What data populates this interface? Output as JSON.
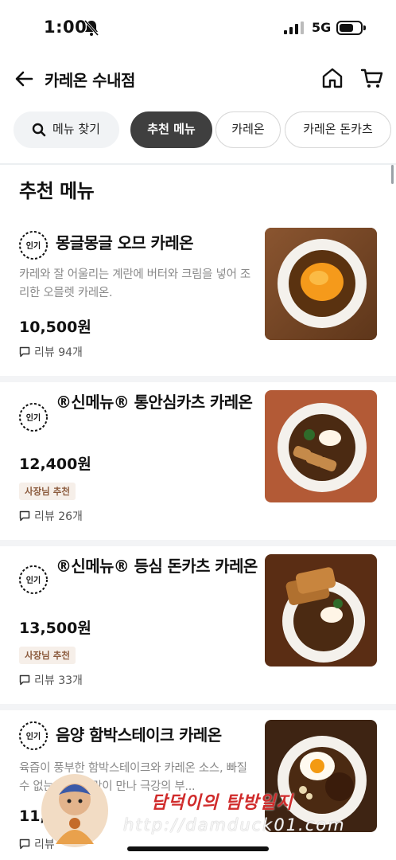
{
  "status_bar": {
    "time": "1:00",
    "network": "5G"
  },
  "header": {
    "title": "카레온 수내점"
  },
  "tabs": [
    {
      "label": "메뉴 찾기"
    },
    {
      "label": "추천 메뉴"
    },
    {
      "label": "카레온"
    },
    {
      "label": "카레온 돈카츠"
    }
  ],
  "section": {
    "title": "추천 메뉴"
  },
  "badge_label": "인기",
  "items": [
    {
      "name": "몽글몽글 오므 카레온",
      "description": "카레와 잘 어울리는 계란에 버터와 크림을 넣어 조리한 오믈렛 카레온.",
      "price": "10,500원",
      "tag": "",
      "reviews": "리뷰 94개"
    },
    {
      "name": "®신메뉴® 통안심카츠 카레온",
      "description": "",
      "price": "12,400원",
      "tag": "사장님 추천",
      "reviews": "리뷰 26개"
    },
    {
      "name": "®신메뉴® 등심 돈카츠 카레온",
      "description": "",
      "price": "13,500원",
      "tag": "사장님 추천",
      "reviews": "리뷰 33개"
    },
    {
      "name": "음양 함박스테이크 카레온",
      "description": "육즙이 풍부한 함박스테이크와 카레온 소스, 빠질 수 없는 반숙 계란이 만나 극강의 부...",
      "price": "11,",
      "tag": "",
      "reviews": "리뷰"
    }
  ],
  "watermark": {
    "title": "담덕이의 탐방일지",
    "url": "http://damduck01.com"
  },
  "colors": {
    "active_tab": "#3f3f3f",
    "tag_bg": "#f6efe9",
    "tag_text": "#8b5a3c",
    "watermark": "#d02b2b"
  }
}
